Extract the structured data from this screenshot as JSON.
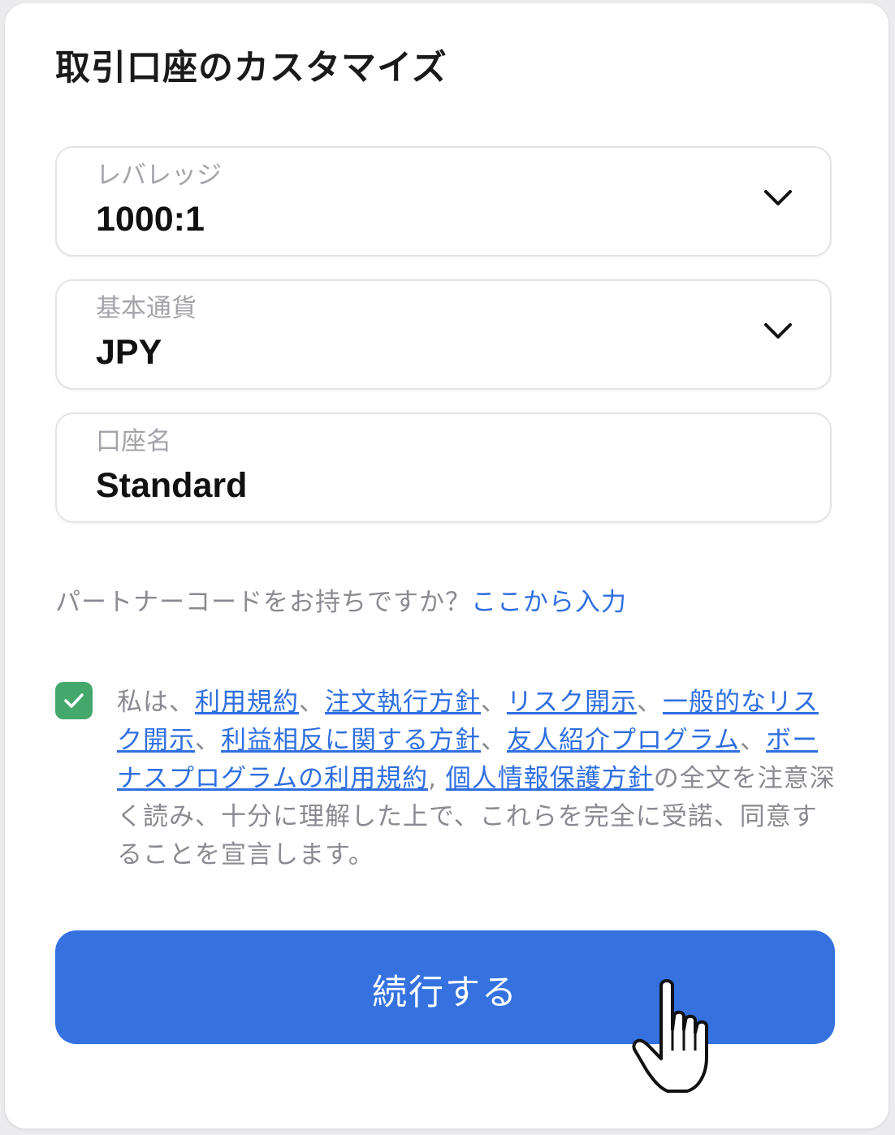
{
  "card": {
    "title": "取引口座のカスタマイズ"
  },
  "fields": {
    "leverage": {
      "label": "レバレッジ",
      "value": "1000:1",
      "icon": "chevron-down-icon"
    },
    "base_currency": {
      "label": "基本通貨",
      "value": "JPY",
      "icon": "chevron-down-icon"
    },
    "account_name": {
      "label": "口座名",
      "value": "Standard"
    }
  },
  "partner": {
    "question": "パートナーコードをお持ちですか？",
    "link": "ここから入力"
  },
  "terms": {
    "checked": true,
    "prefix": "私は、",
    "links": [
      "利用規約",
      "注文執行方針",
      "リスク開示",
      "一般的なリスク開示",
      "利益相反に関する方針",
      "友人紹介プログラム",
      "ボーナスプログラムの利用規約",
      "個人情報保護方針"
    ],
    "separator": "、",
    "suffix": "の全文を注意深く読み、十分に理解した上で、これらを完全に受諾、同意することを宣言します。"
  },
  "actions": {
    "continue_label": "続行する"
  },
  "colors": {
    "accent": "#3572e0",
    "link": "#2f6fe0",
    "checkbox": "#43a86a",
    "muted_text": "#8a8a92",
    "label_text": "#a3a3aa"
  }
}
